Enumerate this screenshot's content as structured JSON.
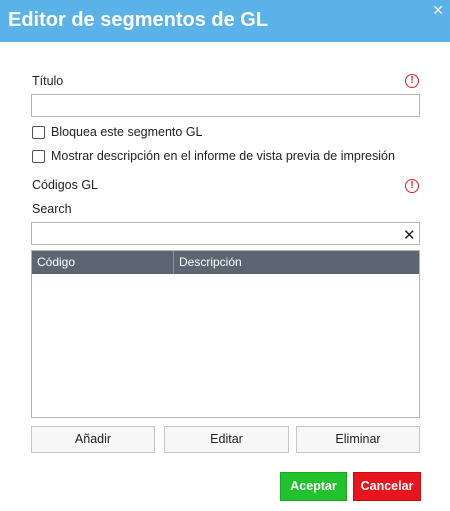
{
  "dialog": {
    "title": "Editor de segmentos de GL",
    "close_glyph": "✕"
  },
  "form": {
    "title_label": "Título",
    "title_value": "",
    "required_glyph": "!",
    "lock_label": "Bloquea este segmento GL",
    "lock_checked": false,
    "show_desc_label": "Mostrar descripción en el informe de vista previa de impresión",
    "show_desc_checked": false,
    "codes_label": "Códigos GL",
    "search_label": "Search",
    "search_value": "",
    "clear_glyph": "✕"
  },
  "table": {
    "columns": [
      "Código",
      "Descripción"
    ],
    "rows": []
  },
  "actions": {
    "add": "Añadir",
    "edit": "Editar",
    "delete": "Eliminar",
    "accept": "Aceptar",
    "cancel": "Cancelar"
  },
  "colors": {
    "titlebar": "#5ab2e8",
    "header": "#5c6673",
    "accept": "#21c32d",
    "cancel": "#e8141e",
    "required": "#d92020"
  },
  "icons": {
    "close": "close-icon",
    "required": "alert-circle-icon",
    "clear": "clear-icon"
  }
}
